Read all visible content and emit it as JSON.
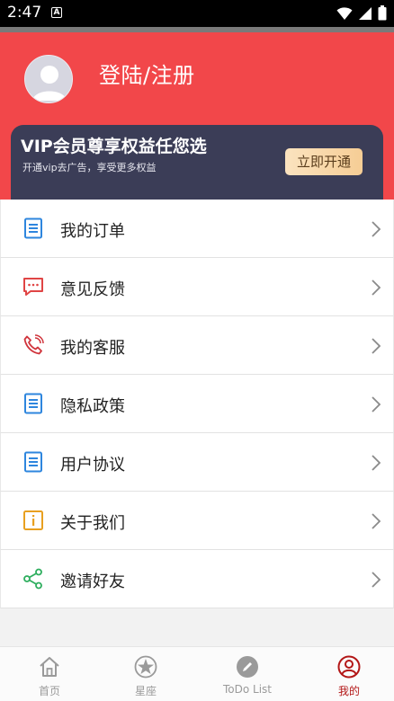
{
  "status_bar": {
    "time": "2:47",
    "notification_icon": "A"
  },
  "header": {
    "login_text": "登陆/注册"
  },
  "vip": {
    "title": "VIP会员尊享权益任您选",
    "subtitle": "开通vip去广告，享受更多权益",
    "button": "立即开通"
  },
  "menu": [
    {
      "label": "我的订单",
      "icon": "document-icon"
    },
    {
      "label": "意见反馈",
      "icon": "message-icon"
    },
    {
      "label": "我的客服",
      "icon": "phone-icon"
    },
    {
      "label": "隐私政策",
      "icon": "document-icon"
    },
    {
      "label": "用户协议",
      "icon": "document-icon"
    },
    {
      "label": "关于我们",
      "icon": "info-icon"
    },
    {
      "label": "邀请好友",
      "icon": "share-icon"
    }
  ],
  "tabs": [
    {
      "label": "首页",
      "icon": "home-icon"
    },
    {
      "label": "星座",
      "icon": "star-icon"
    },
    {
      "label": "ToDo List",
      "icon": "pencil-icon"
    },
    {
      "label": "我的",
      "icon": "profile-icon",
      "active": true
    }
  ],
  "colors": {
    "header_red": "#f2474a",
    "vip_card": "#3b3d57",
    "active_tab": "#b31717"
  }
}
